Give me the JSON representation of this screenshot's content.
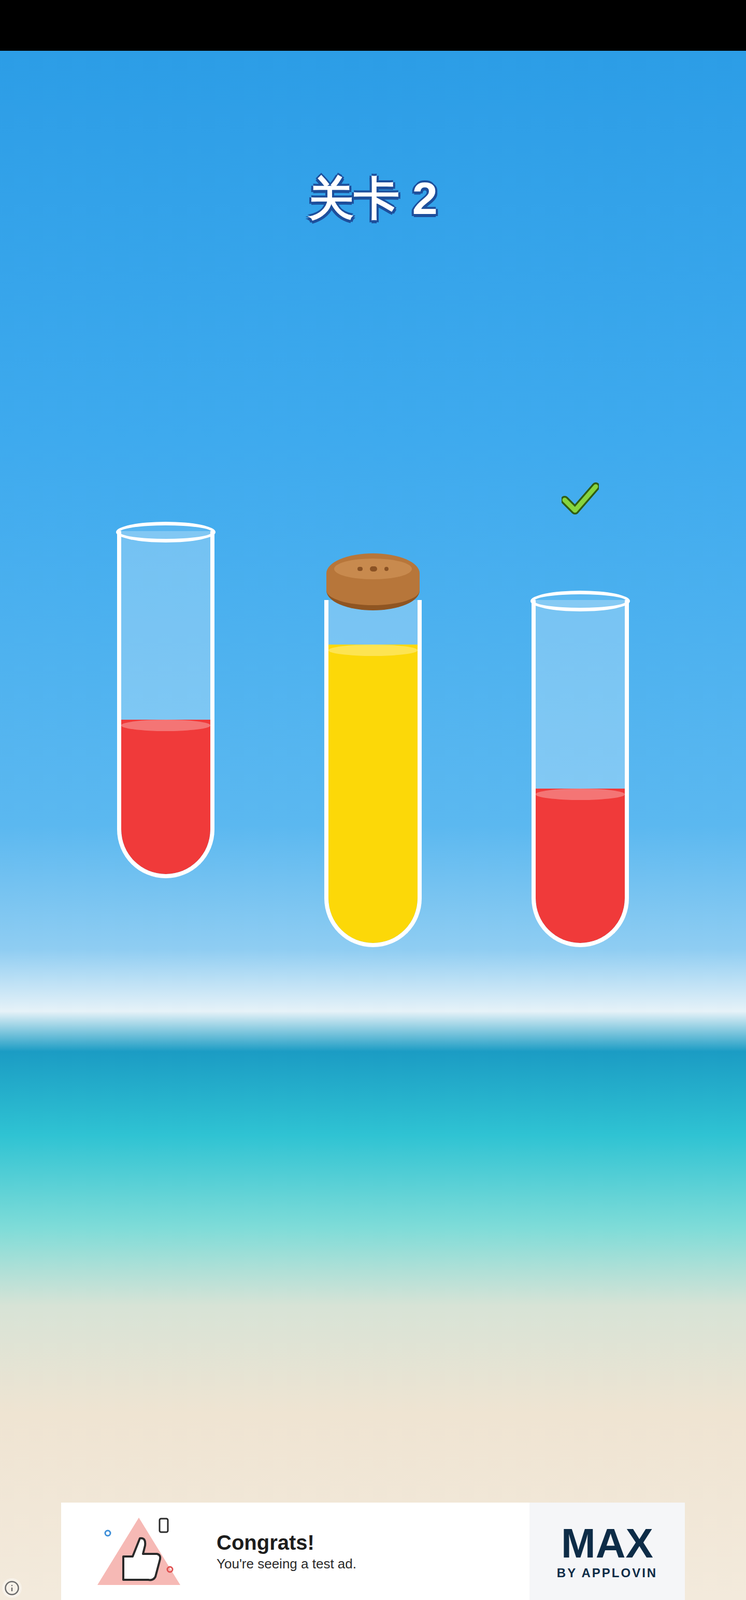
{
  "title": "关卡 2",
  "tubes": [
    {
      "color": "#f03a3a",
      "level": 0.45,
      "selected": true,
      "sealed": false,
      "checked": false
    },
    {
      "color": "#fcd808",
      "level": 0.87,
      "selected": false,
      "sealed": true,
      "checked": false
    },
    {
      "color": "#f03a3a",
      "level": 0.45,
      "selected": false,
      "sealed": false,
      "checked": true
    }
  ],
  "ad": {
    "headline": "Congrats!",
    "subtext": "You're seeing a test ad.",
    "brand": "MAX",
    "brand_sub": "BY APPLOVIN"
  }
}
